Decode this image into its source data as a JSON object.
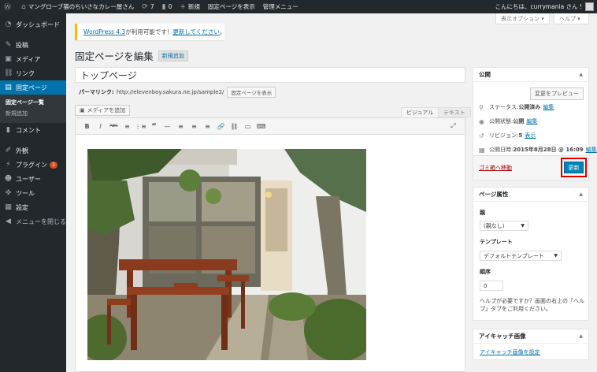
{
  "adminbar": {
    "site_name": "マングローブ猫のちいさなカレー屋さん",
    "updates_count": "7",
    "comments_count": "0",
    "new_label": "新規",
    "view_page": "固定ページを表示",
    "admin_menu": "管理メニュー",
    "greeting": "こんにちは、currymania さん !"
  },
  "screen_meta": {
    "options": "表示オプション ▾",
    "help": "ヘルプ ▾"
  },
  "menu": {
    "dashboard": "ダッシュボード",
    "posts": "投稿",
    "media": "メディア",
    "links": "リンク",
    "pages": "固定ページ",
    "pages_sub": [
      "固定ページ一覧",
      "新規追加"
    ],
    "comments": "コメント",
    "appearance": "外観",
    "plugins": "プラグイン",
    "plugins_badge": "3",
    "users": "ユーザー",
    "tools": "ツール",
    "settings": "設定",
    "collapse": "メニューを閉じる"
  },
  "notice": {
    "link1": "WordPress 4.3",
    "text": " が利用可能です！",
    "link2": "更新してください",
    "end": "。"
  },
  "page": {
    "heading": "固定ページを編集",
    "add_new": "新規追加"
  },
  "editor": {
    "title": "トップページ",
    "permalink_label": "パーマリンク:",
    "permalink_url": "http://elevenboy.sakura.ne.jp/sample2/",
    "view_page_btn": "固定ページを表示",
    "media_btn": "メディアを追加",
    "tab_visual": "ビジュアル",
    "tab_text": "テキスト",
    "toolbar": [
      "B",
      "I",
      "ABC",
      "≡",
      "⋮≡",
      "“",
      "—",
      "≡",
      "≡",
      "≡",
      "🔗",
      "⛓",
      "▭",
      "⌨"
    ]
  },
  "publish": {
    "title": "公開",
    "preview_btn": "変更をプレビュー",
    "status_label": "ステータス: ",
    "status_value": "公開済み",
    "visibility_label": "公開状態: ",
    "visibility_value": "公開",
    "revisions_label": "リビジョン: ",
    "revisions_value": "5",
    "revisions_link": "表示",
    "date_label": "公開日時: ",
    "date_value": "2015年8月28日 @ 16:09",
    "edit": "編集",
    "trash": "ゴミ箱へ移動",
    "update_btn": "更新"
  },
  "page_attributes": {
    "title": "ページ属性",
    "parent_label": "親",
    "parent_value": "(親なし)",
    "template_label": "テンプレート",
    "template_value": "デフォルトテンプレート",
    "order_label": "順序",
    "order_value": "0",
    "help_text": "ヘルプが必要ですか？画面の右上の「ヘルプ」タブをご利用ください。"
  },
  "featured_image": {
    "title": "アイキャッチ画像",
    "link": "アイキャッチ画像を設定"
  },
  "colors": {
    "admin_dark": "#23282d",
    "accent": "#0073aa",
    "update_button": "#0085ba",
    "highlight": "#e00000"
  }
}
